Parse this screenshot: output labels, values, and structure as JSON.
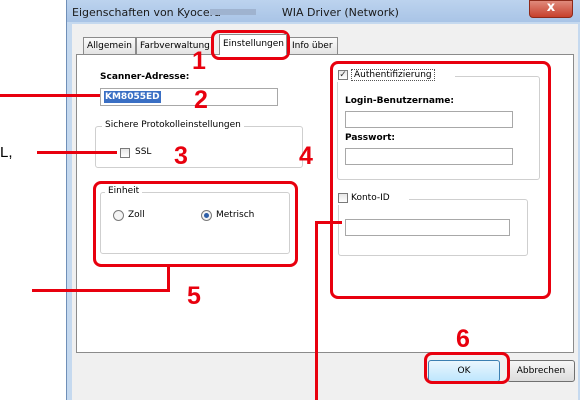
{
  "window": {
    "title_left": "Eigenschaften von Kyocera",
    "title_right": "WIA Driver (Network)",
    "close_glyph": "x"
  },
  "tabs": [
    "Allgemein",
    "Farbverwaltung",
    "Einstellungen",
    "Info über"
  ],
  "scanner": {
    "address_label": "Scanner-Adresse:",
    "address_value": "KM8055ED"
  },
  "protocol": {
    "group_label": "Sichere Protokolleinstellungen",
    "ssl_label": "SSL"
  },
  "unit": {
    "group_label": "Einheit",
    "option_inch": "Zoll",
    "option_metric": "Metrisch",
    "selected": "Metrisch"
  },
  "auth": {
    "checkbox_label": "Authentifizierung",
    "checked": true,
    "username_label": "Login-Benutzername:",
    "password_label": "Passwort:"
  },
  "account": {
    "checkbox_label": "Konto-ID"
  },
  "buttons": {
    "ok": "OK",
    "cancel": "Abbrechen"
  },
  "callouts": [
    "1",
    "2",
    "3",
    "4",
    "5",
    "6"
  ],
  "left_fragment": "L,",
  "colors": {
    "highlight": "#e8000e",
    "titlebar": "#a9c4e6",
    "selection": "#3a6fc4"
  }
}
